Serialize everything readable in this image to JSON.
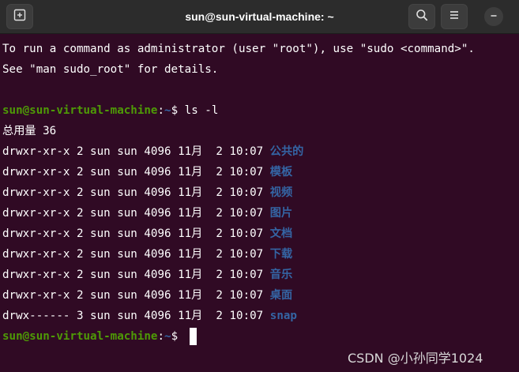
{
  "window": {
    "title": "sun@sun-virtual-machine: ~"
  },
  "colors": {
    "background": "#300a24",
    "titlebar": "#2c2c2c",
    "prompt_user": "#4e9a06",
    "prompt_path": "#3465a4",
    "directory": "#3465a4",
    "text": "#ffffff"
  },
  "icons": {
    "new_tab": "new-tab-icon",
    "search": "search-icon",
    "menu": "hamburger-menu-icon",
    "minimize": "minimize-icon"
  },
  "terminal": {
    "motd": [
      "To run a command as administrator (user \"root\"), use \"sudo <command>\".",
      "See \"man sudo_root\" for details."
    ],
    "prompt": {
      "user_host": "sun@sun-virtual-machine",
      "colon": ":",
      "path": "~",
      "symbol": "$ "
    },
    "command": "ls -l",
    "total": "总用量 36",
    "listing": [
      {
        "info": "drwxr-xr-x 2 sun sun 4096 11月  2 10:07 ",
        "name": "公共的"
      },
      {
        "info": "drwxr-xr-x 2 sun sun 4096 11月  2 10:07 ",
        "name": "模板"
      },
      {
        "info": "drwxr-xr-x 2 sun sun 4096 11月  2 10:07 ",
        "name": "视频"
      },
      {
        "info": "drwxr-xr-x 2 sun sun 4096 11月  2 10:07 ",
        "name": "图片"
      },
      {
        "info": "drwxr-xr-x 2 sun sun 4096 11月  2 10:07 ",
        "name": "文档"
      },
      {
        "info": "drwxr-xr-x 2 sun sun 4096 11月  2 10:07 ",
        "name": "下载"
      },
      {
        "info": "drwxr-xr-x 2 sun sun 4096 11月  2 10:07 ",
        "name": "音乐"
      },
      {
        "info": "drwxr-xr-x 2 sun sun 4096 11月  2 10:07 ",
        "name": "桌面"
      },
      {
        "info": "drwx------ 3 sun sun 4096 11月  2 10:07 ",
        "name": "snap"
      }
    ]
  },
  "watermark": "CSDN @小孙同学1024"
}
